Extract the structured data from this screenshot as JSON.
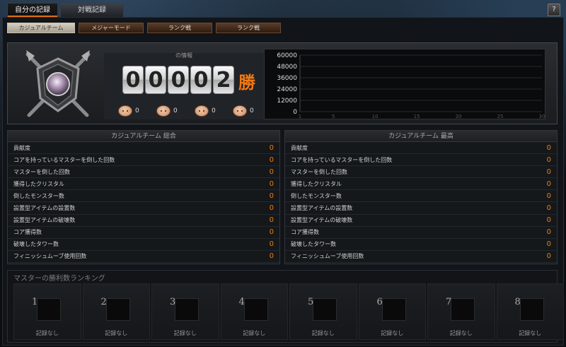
{
  "tabs": {
    "top": [
      {
        "label": "自分の記録",
        "active": true
      },
      {
        "label": "対戦記録",
        "active": false
      }
    ]
  },
  "help_button": "?",
  "sub_tabs": [
    {
      "label": "カジュアルチーム",
      "active": true
    },
    {
      "label": "メジャーモード",
      "active": false
    },
    {
      "label": "ランク戦",
      "active": false
    },
    {
      "label": "ランク戦",
      "active": false
    }
  ],
  "record": {
    "title": "の情報",
    "wins_digits": [
      "0",
      "0",
      "0",
      "0",
      "2"
    ],
    "wins_suffix": "勝",
    "stats": [
      "0",
      "0",
      "0",
      "0"
    ]
  },
  "chart_data": {
    "type": "line",
    "x_ticks": [
      "1",
      "5",
      "10",
      "15",
      "20",
      "25",
      "30"
    ],
    "y_ticks": [
      "0",
      "12000",
      "24000",
      "36000",
      "48000",
      "60000"
    ],
    "ylim": [
      0,
      60000
    ],
    "xlim": [
      1,
      30
    ],
    "series": [],
    "grid": true
  },
  "tables": {
    "left": {
      "title": "カジュアルチーム 総合",
      "rows": [
        {
          "label": "貢献度",
          "value": "0"
        },
        {
          "label": "コアを持っているマスターを倒した回数",
          "value": "0"
        },
        {
          "label": "マスターを倒した回数",
          "value": "0"
        },
        {
          "label": "獲得したクリスタル",
          "value": "0"
        },
        {
          "label": "倒したモンスター数",
          "value": "0"
        },
        {
          "label": "設置型アイテムの設置数",
          "value": "0"
        },
        {
          "label": "設置型アイテムの破壊数",
          "value": "0"
        },
        {
          "label": "コア獲得数",
          "value": "0"
        },
        {
          "label": "破壊したタワー数",
          "value": "0"
        },
        {
          "label": "フィニッシュムーブ使用回数",
          "value": "0"
        }
      ]
    },
    "right": {
      "title": "カジュアルチーム 最高",
      "rows": [
        {
          "label": "貢献度",
          "value": "0"
        },
        {
          "label": "コアを持っているマスターを倒した回数",
          "value": "0"
        },
        {
          "label": "マスターを倒した回数",
          "value": "0"
        },
        {
          "label": "獲得したクリスタル",
          "value": "0"
        },
        {
          "label": "倒したモンスター数",
          "value": "0"
        },
        {
          "label": "設置型アイテムの設置数",
          "value": "0"
        },
        {
          "label": "設置型アイテムの破壊数",
          "value": "0"
        },
        {
          "label": "コア獲得数",
          "value": "0"
        },
        {
          "label": "破壊したタワー数",
          "value": "0"
        },
        {
          "label": "フィニッシュムーブ使用回数",
          "value": "0"
        }
      ]
    }
  },
  "ranking": {
    "title": "マスターの勝利数ランキング",
    "slots": [
      {
        "rank": "1",
        "label": "記録なし"
      },
      {
        "rank": "2",
        "label": "記録なし"
      },
      {
        "rank": "3",
        "label": "記録なし"
      },
      {
        "rank": "4",
        "label": "記録なし"
      },
      {
        "rank": "5",
        "label": "記録なし"
      },
      {
        "rank": "6",
        "label": "記録なし"
      },
      {
        "rank": "7",
        "label": "記録なし"
      },
      {
        "rank": "8",
        "label": "記録なし"
      }
    ]
  },
  "colors": {
    "accent": "#f07810",
    "tab_active_underline": "#e07010"
  }
}
